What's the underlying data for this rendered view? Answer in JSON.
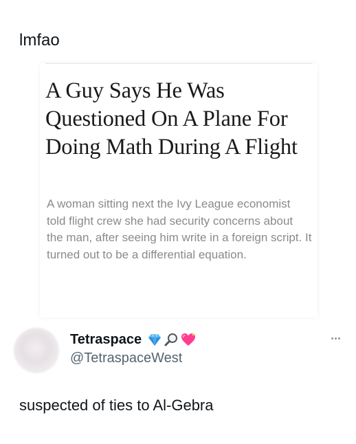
{
  "post": {
    "caption": "lmfao"
  },
  "article": {
    "headline": "A Guy Says He Was Questioned On A Plane For Doing Math During A Flight",
    "dek": "A woman sitting next the Ivy League economist told flight crew she had security concerns about the man, after seeing him write in a foreign script. It turned out to be a differential equation."
  },
  "quoted_tweet": {
    "display_name": "Tetraspace",
    "handle": "@TetraspaceWest",
    "badges": [
      "gem-icon",
      "magnifying-glass-icon",
      "sparkling-heart-icon"
    ],
    "text": "suspected of ties to Al-Gebra"
  },
  "colors": {
    "text_primary": "#0f1419",
    "text_secondary": "#536471",
    "dek_gray": "#8a8a8a",
    "gem_blue": "#3aa0e8",
    "heart_pink": "#ff2f8a"
  }
}
